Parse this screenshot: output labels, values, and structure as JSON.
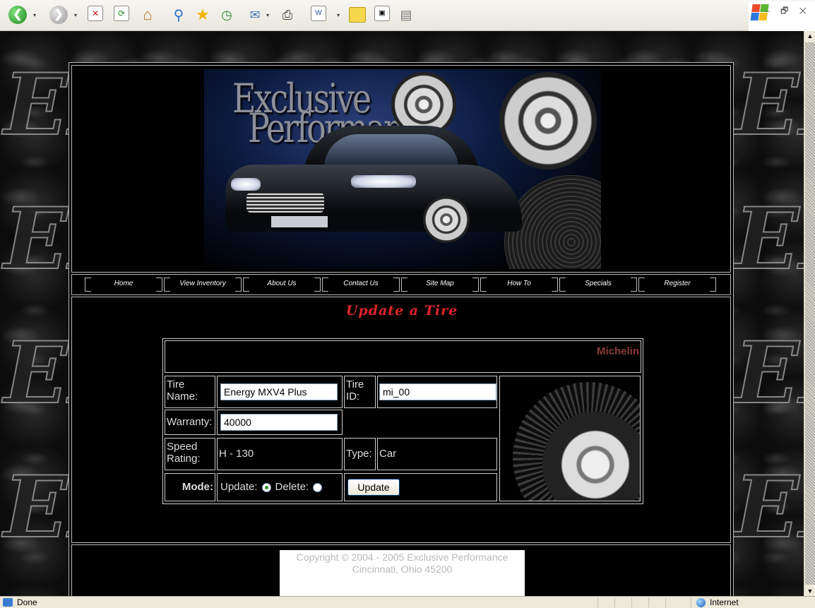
{
  "browser": {
    "toolbar_icons": [
      "back-icon",
      "forward-icon",
      "stop-icon",
      "refresh-icon",
      "home-icon",
      "search-icon",
      "favorites-icon",
      "history-icon",
      "mail-icon",
      "print-icon",
      "edit-icon",
      "discuss-icon",
      "messenger-icon",
      "research-icon"
    ],
    "status": "Done",
    "zone": "Internet",
    "window_controls": "– 🗗 ✕"
  },
  "site": {
    "logo_line1": "Exclusive",
    "logo_line2": "Performance",
    "bg_monogram": "EP",
    "nav": [
      {
        "label": "Home"
      },
      {
        "label": "View Inventory"
      },
      {
        "label": "About Us"
      },
      {
        "label": "Contact Us"
      },
      {
        "label": "Site Map"
      },
      {
        "label": "How To"
      },
      {
        "label": "Specials"
      },
      {
        "label": "Register"
      }
    ],
    "page_title": "Update a Tire",
    "brand": "Michelin",
    "form": {
      "tire_name_label": "Tire Name:",
      "tire_name_value": "Energy MXV4 Plus",
      "tire_id_label": "Tire ID:",
      "tire_id_value": "mi_00",
      "warranty_label": "Warranty:",
      "warranty_value": "40000",
      "speed_label": "Speed Rating:",
      "speed_value": "H - 130",
      "type_label": "Type:",
      "type_value": "Car",
      "mode_label": "Mode:",
      "update_option": "Update:",
      "delete_option": "Delete:",
      "selected_mode": "Update",
      "submit_label": "Update"
    },
    "footer": {
      "line1": "Copyright © 2004 - 2005 Exclusive Performance",
      "line2": "Cincinnati, Ohio 45200"
    }
  },
  "colors": {
    "title_red": "#e0242b",
    "brand_maroon": "#8b3a3a",
    "border_gray": "#cccccc"
  }
}
